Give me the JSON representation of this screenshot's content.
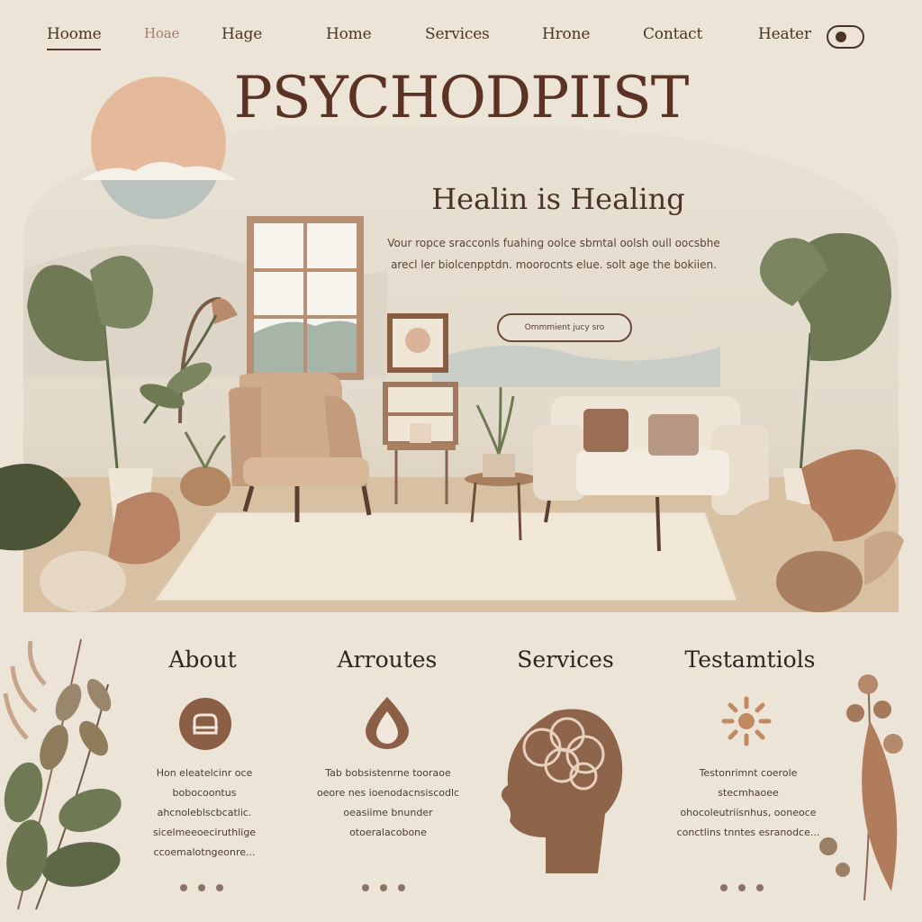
{
  "nav": {
    "items": [
      {
        "label": "Hoome"
      },
      {
        "label": "Hoae"
      },
      {
        "label": "Hage"
      },
      {
        "label": "Home"
      },
      {
        "label": "Services"
      },
      {
        "label": "Hrone"
      },
      {
        "label": "Contact"
      },
      {
        "label": "Heater"
      }
    ]
  },
  "hero": {
    "brand": "PSYCHODPIIST",
    "tagline": "Healin is Healing",
    "body": "Vour ropce sracconls fuahing oolce sbmtal oolsh oull oocsbhe arecl ler biolcenpptdn. moorocnts elue. solt age the bokiien.",
    "cta": "Ommmient jucy sro"
  },
  "sections": [
    {
      "title": "About",
      "text": "Hon eleatelcinr oce bobocoontus ahcnoleblscbcatlic. sicelmeeoeciruthlige ccoemalotngeonre..."
    },
    {
      "title": "Arroutes",
      "text": "Tab bobsistenrne tooraoe oeore nes ioenodacnsiscodlc oeasiime bnunder otoeralacobone"
    },
    {
      "title": "Services",
      "text": ""
    },
    {
      "title": "Testamtiols",
      "text": "Testonrimnt coerole stecmhaoee ohocoleutriisnhus, ooneoce conctlins tnntes esranodce..."
    }
  ],
  "colors": {
    "background": "#ece5d7",
    "accent": "#5a3324",
    "leaf": "#6f7a55",
    "clay": "#b07c5c"
  },
  "icons": [
    "chair-icon",
    "droplet-icon",
    "head-brain-icon",
    "sun-icon",
    "toggle-icon"
  ]
}
